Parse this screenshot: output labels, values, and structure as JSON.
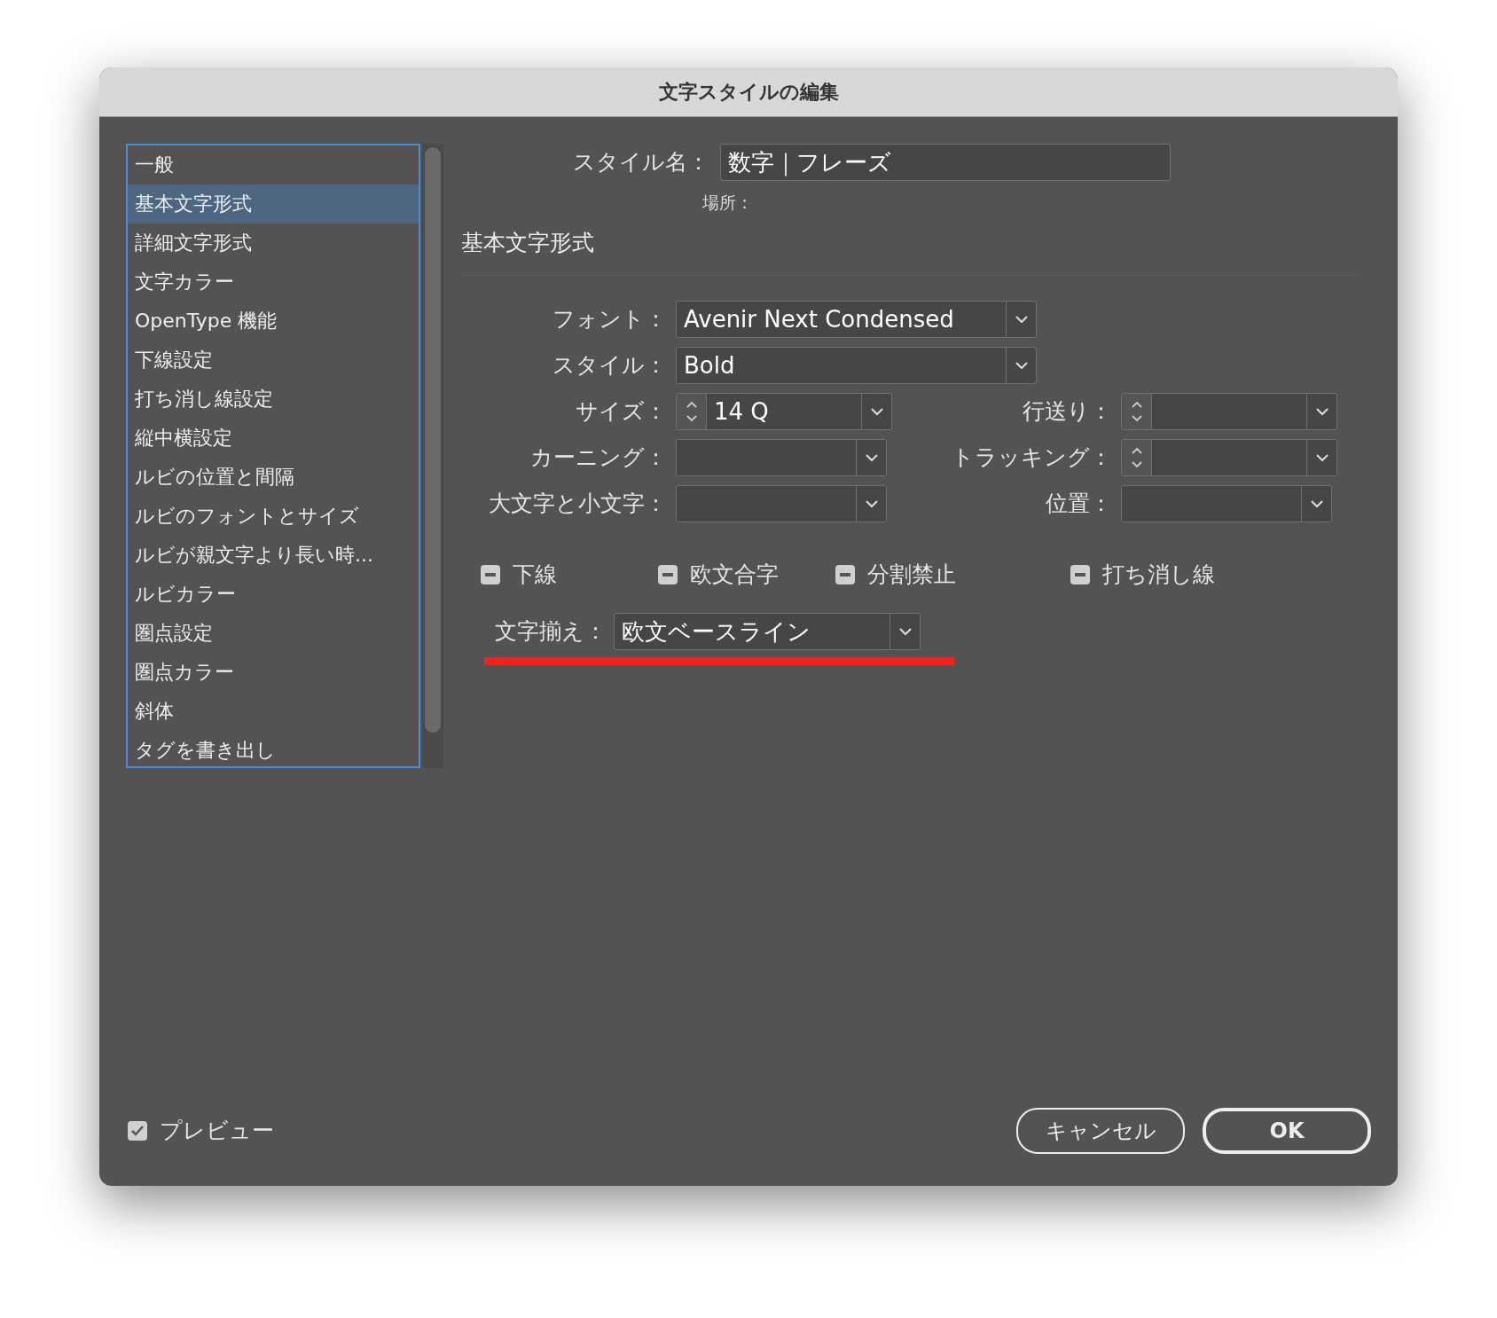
{
  "window": {
    "title": "文字スタイルの編集"
  },
  "sidebar": {
    "items": [
      {
        "label": "一般",
        "selected": false
      },
      {
        "label": "基本文字形式",
        "selected": true
      },
      {
        "label": "詳細文字形式",
        "selected": false
      },
      {
        "label": "文字カラー",
        "selected": false
      },
      {
        "label": "OpenType 機能",
        "selected": false
      },
      {
        "label": "下線設定",
        "selected": false
      },
      {
        "label": "打ち消し線設定",
        "selected": false
      },
      {
        "label": "縦中横設定",
        "selected": false
      },
      {
        "label": "ルビの位置と間隔",
        "selected": false
      },
      {
        "label": "ルビのフォントとサイズ",
        "selected": false
      },
      {
        "label": "ルビが親文字より長い時...",
        "selected": false
      },
      {
        "label": "ルビカラー",
        "selected": false
      },
      {
        "label": "圏点設定",
        "selected": false
      },
      {
        "label": "圏点カラー",
        "selected": false
      },
      {
        "label": "斜体",
        "selected": false
      },
      {
        "label": "タグを書き出し",
        "selected": false
      }
    ]
  },
  "style_name": {
    "label": "スタイル名：",
    "value": "数字｜フレーズ"
  },
  "location": {
    "label": "場所："
  },
  "section_title": "基本文字形式",
  "rows": [
    {
      "left": {
        "label": "フォント：",
        "value": "Avenir Next Condensed",
        "kind": "wide"
      }
    },
    {
      "left": {
        "label": "スタイル：",
        "value": "Bold",
        "kind": "wide"
      }
    },
    {
      "left": {
        "label": "サイズ：",
        "value": "14 Q",
        "kind": "spin"
      },
      "right": {
        "label": "行送り：",
        "kind": "spin"
      }
    },
    {
      "left": {
        "label": "カーニング：",
        "kind": "dropdown"
      },
      "right": {
        "label": "トラッキング：",
        "kind": "spin"
      }
    },
    {
      "left": {
        "label": "大文字と小文字：",
        "kind": "dropdown"
      },
      "right": {
        "label": "位置：",
        "kind": "dropdown"
      }
    }
  ],
  "checkboxes": [
    {
      "label": "下線",
      "indeterminate": true
    },
    {
      "label": "欧文合字",
      "indeterminate": true
    },
    {
      "label": "分割禁止",
      "indeterminate": true
    },
    {
      "label": "打ち消し線",
      "indeterminate": true
    }
  ],
  "alignment": {
    "label": "文字揃え：",
    "value": "欧文ベースライン"
  },
  "preview": {
    "label": "プレビュー",
    "checked": true
  },
  "buttons": [
    {
      "label": "キャンセル",
      "default": false
    },
    {
      "label": "OK",
      "default": true
    }
  ]
}
